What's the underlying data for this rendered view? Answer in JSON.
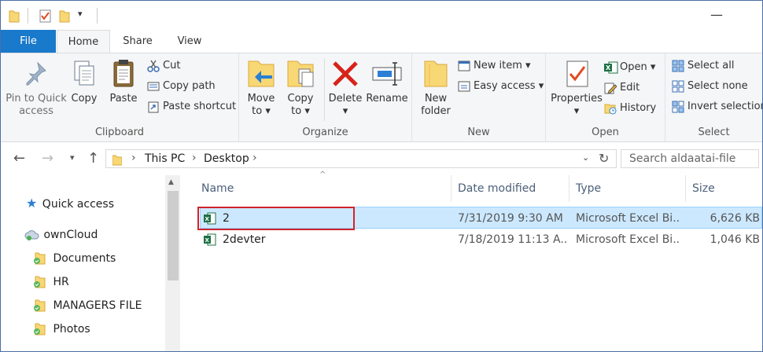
{
  "tabs": {
    "file": "File",
    "home": "Home",
    "share": "Share",
    "view": "View"
  },
  "clipboard": {
    "pin_label_1": "Pin to Quick",
    "pin_label_2": "access",
    "copy": "Copy",
    "paste": "Paste",
    "cut": "Cut",
    "copy_path": "Copy path",
    "paste_shortcut": "Paste shortcut",
    "group": "Clipboard"
  },
  "organize": {
    "move_1": "Move",
    "move_2": "to",
    "copy_1": "Copy",
    "copy_2": "to",
    "delete": "Delete",
    "rename": "Rename",
    "group": "Organize"
  },
  "new": {
    "folder_1": "New",
    "folder_2": "folder",
    "new_item": "New item",
    "easy_access": "Easy access",
    "group": "New"
  },
  "open": {
    "properties": "Properties",
    "open": "Open",
    "edit": "Edit",
    "history": "History",
    "group": "Open"
  },
  "select": {
    "select_all": "Select all",
    "select_none": "Select none",
    "invert": "Invert selection",
    "group": "Select"
  },
  "address": {
    "crumbs": [
      "This PC",
      "Desktop"
    ],
    "search_placeholder": "Search aldaatai-file"
  },
  "nav_pane": {
    "quick_access": "Quick access",
    "owncloud": "ownCloud",
    "folders": [
      "Documents",
      "HR",
      "MANAGERS FILE",
      "Photos"
    ]
  },
  "columns": {
    "name": "Name",
    "date": "Date modified",
    "type": "Type",
    "size": "Size"
  },
  "files": [
    {
      "name": "2",
      "date": "7/31/2019 9:30 AM",
      "type": "Microsoft Excel Bi...",
      "size": "6,626 KB",
      "selected": true
    },
    {
      "name": "2devter",
      "date": "7/18/2019 11:13 A...",
      "type": "Microsoft Excel Bi...",
      "size": "1,046 KB",
      "selected": false
    }
  ],
  "colors": {
    "accent": "#1979ca",
    "selection": "#cce8ff",
    "highlight_box": "#d0232d"
  }
}
